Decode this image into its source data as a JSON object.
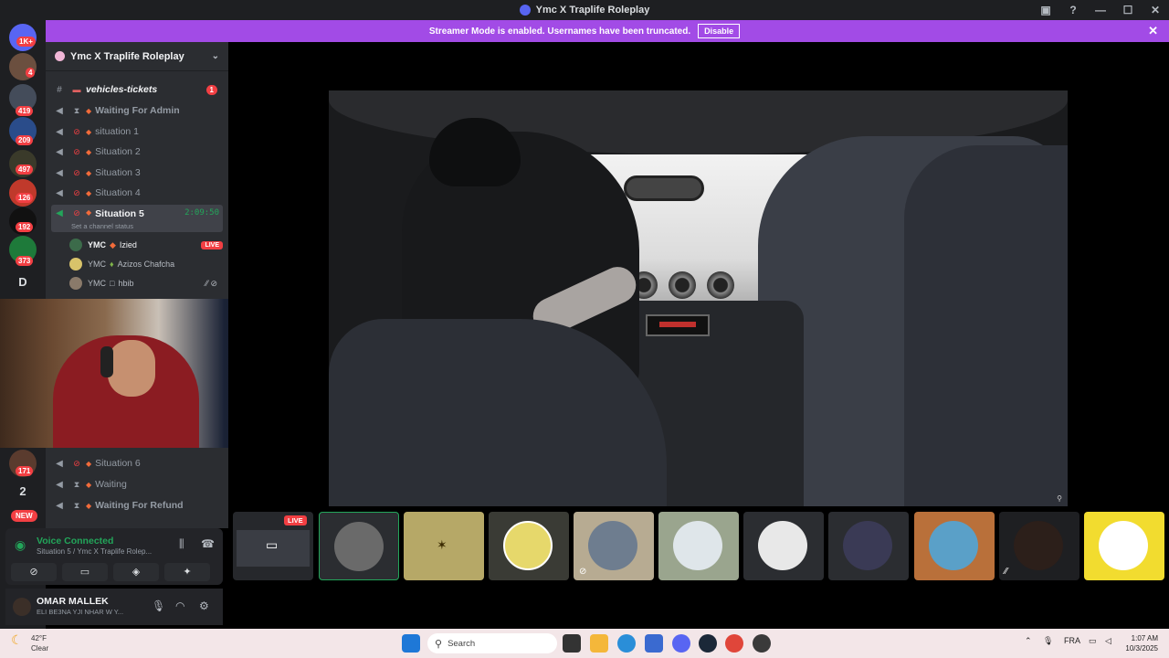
{
  "window": {
    "title": "Ymc X Traplife Roleplay"
  },
  "banner": {
    "text": "Streamer Mode is enabled. Usernames have been truncated.",
    "disable_label": "Disable"
  },
  "servers": [
    {
      "badge": "1K+"
    },
    {
      "badge": "4"
    },
    {
      "badge": "419"
    },
    {
      "badge": "209"
    },
    {
      "badge": "497"
    },
    {
      "badge": "126"
    },
    {
      "badge": "192"
    },
    {
      "badge": "373"
    },
    {
      "letter": "D"
    },
    {
      "badge": "171"
    },
    {
      "letter": "2"
    },
    {
      "badge": "NEW"
    }
  ],
  "guild": {
    "name": "Ymc X Traplife Roleplay"
  },
  "channels": [
    {
      "name": "vehicles-tickets",
      "unread": "1"
    },
    {
      "name": "Waiting For Admin"
    },
    {
      "name": "situation 1"
    },
    {
      "name": "Situation 2"
    },
    {
      "name": "Situation 3"
    },
    {
      "name": "Situation 4"
    },
    {
      "name": "Situation 5",
      "timer": "2:09:50",
      "status": "Set a channel status"
    },
    {
      "name": "Situation 6"
    },
    {
      "name": "Waiting"
    },
    {
      "name": "Waiting For Refund"
    }
  ],
  "members": [
    {
      "prefix": "YMC",
      "name": "Izied",
      "live": "LIVE"
    },
    {
      "prefix": "YMC",
      "name": "Azizos Chafcha"
    },
    {
      "prefix": "YMC",
      "name": "hbib"
    }
  ],
  "voice": {
    "title": "Voice Connected",
    "channel": "Situation 5 / Ymc X Traplife Rolep..."
  },
  "user": {
    "name": "OMAR MALLEK",
    "status": "ELI BE3NA YJI NHAR W Y..."
  },
  "tiles": [
    {
      "live": "LIVE"
    }
  ],
  "taskbar": {
    "weather_temp": "42°F",
    "weather_desc": "Clear",
    "search_placeholder": "Search",
    "lang": "FRA",
    "time": "1:07 AM",
    "date": "10/3/2025"
  },
  "colors": {
    "banner": "#a24be6",
    "live": "#f23f43",
    "voice_green": "#23a55a"
  }
}
